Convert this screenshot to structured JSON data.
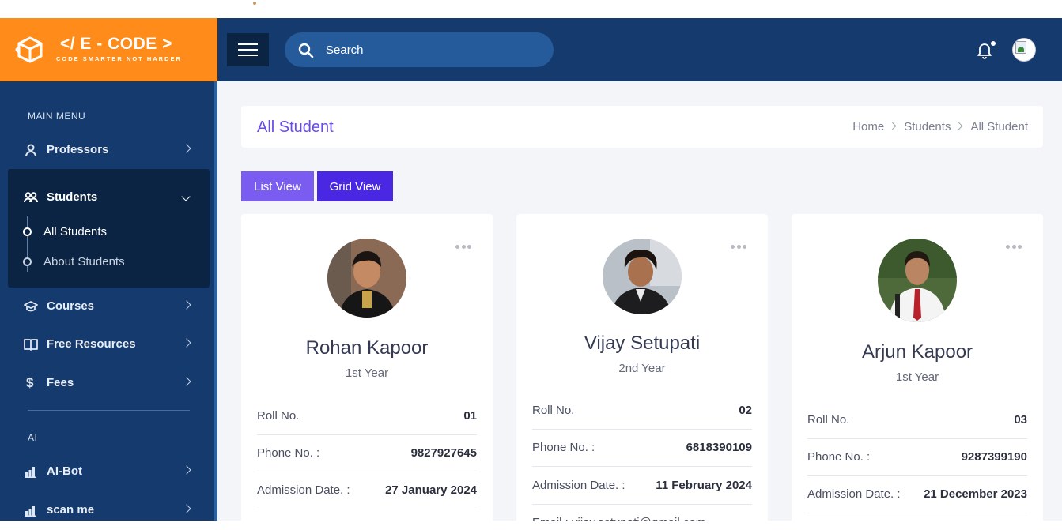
{
  "brand": {
    "name": "</ E - CODE >",
    "tagline": "CODE SMARTER NOT HARDER",
    "color": "#ff8c1a"
  },
  "header": {
    "search_placeholder": "Search",
    "bg": "#143a6e"
  },
  "sidebar": {
    "section_main": "MAIN MENU",
    "items": [
      {
        "label": "Professors",
        "icon": "user-icon"
      },
      {
        "label": "Students",
        "icon": "students-icon",
        "expanded": true,
        "children": [
          {
            "label": "All Students",
            "active": true
          },
          {
            "label": "About Students"
          }
        ]
      },
      {
        "label": "Courses",
        "icon": "graduation-cap-icon"
      },
      {
        "label": "Free Resources",
        "icon": "book-open-icon"
      },
      {
        "label": "Fees",
        "icon": "dollar-icon"
      }
    ],
    "section_ai": "AI",
    "ai_items": [
      {
        "label": "AI-Bot",
        "icon": "bar-chart-icon"
      },
      {
        "label": "scan me",
        "icon": "bar-chart-icon"
      }
    ]
  },
  "page": {
    "title": "All Student",
    "breadcrumb": [
      "Home",
      "Students",
      "All Student"
    ],
    "list_view": "List View",
    "grid_view": "Grid View"
  },
  "students": [
    {
      "name": "Rohan Kapoor",
      "year": "1st Year",
      "roll_label": "Roll No.",
      "roll": "01",
      "phone_label": "Phone No. :",
      "phone": "9827927645",
      "adm_label": "Admission Date. :",
      "adm": "27 January 2024"
    },
    {
      "name": "Vijay Setupati",
      "year": "2nd Year",
      "roll_label": "Roll No.",
      "roll": "02",
      "phone_label": "Phone No. :",
      "phone": "6818390109",
      "adm_label": "Admission Date. :",
      "adm": "11 February 2024",
      "email_partial": "Email : vijay.setupati@gmail.com"
    },
    {
      "name": "Arjun Kapoor",
      "year": "1st Year",
      "roll_label": "Roll No.",
      "roll": "03",
      "phone_label": "Phone No. :",
      "phone": "9287399190",
      "adm_label": "Admission Date. :",
      "adm": "21 December 2023"
    }
  ]
}
